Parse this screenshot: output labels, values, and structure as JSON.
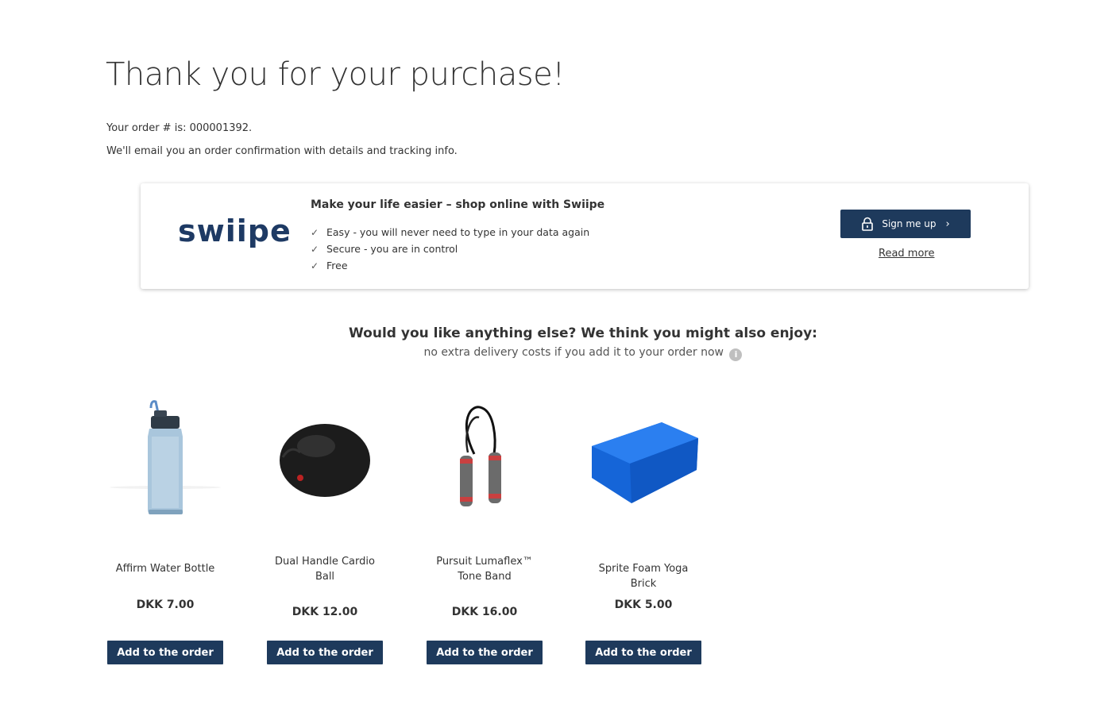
{
  "header": {
    "title": "Thank you for your purchase!",
    "order_line": "Your order # is: 000001392.",
    "email_line": "We'll email you an order confirmation with details and tracking info."
  },
  "swiipe": {
    "logo_text": "swiipe",
    "headline": "Make your life easier – shop online with Swiipe",
    "benefits": [
      "Easy - you will never need to type in your data again",
      "Secure - you are in control",
      "Free"
    ],
    "check_glyph": "✓",
    "signup_label": "Sign me up",
    "chevron_glyph": "›",
    "read_more_label": "Read more",
    "brand_color": "#1e3a5c"
  },
  "upsell": {
    "title": "Would you like anything else? We think you might also enjoy:",
    "subtitle": "no extra delivery costs if you add it to your order now",
    "info_glyph": "i"
  },
  "products": [
    {
      "name": "Affirm Water Bottle",
      "price": "DKK 7.00",
      "button": "Add to the order",
      "icon": "water-bottle-icon"
    },
    {
      "name": "Dual Handle Cardio Ball",
      "price": "DKK 12.00",
      "button": "Add to the order",
      "icon": "cardio-ball-icon"
    },
    {
      "name": "Pursuit Lumaflex™ Tone Band",
      "price": "DKK 16.00",
      "button": "Add to the order",
      "icon": "tone-band-icon"
    },
    {
      "name": "Sprite Foam Yoga Brick",
      "price": "DKK 5.00",
      "button": "Add to the order",
      "icon": "yoga-brick-icon"
    }
  ]
}
